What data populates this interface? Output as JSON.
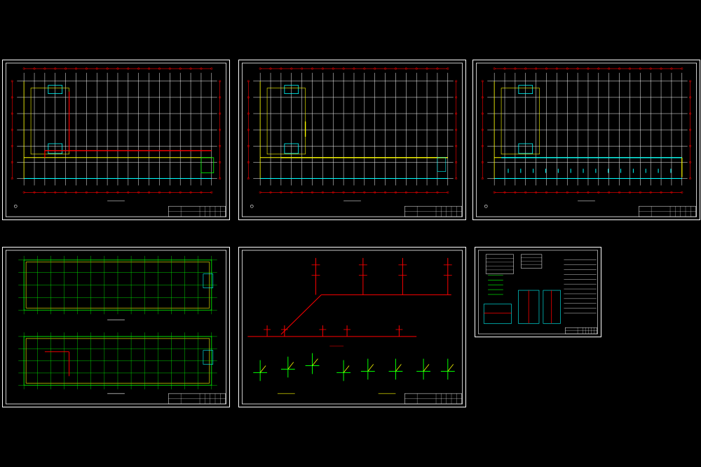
{
  "colors": {
    "background": "#000000",
    "frame": "#ffffff",
    "grid": "#ffffff",
    "axis": "#ff0000",
    "pipe_red": "#ff0000",
    "pipe_yellow": "#ffff00",
    "pipe_cyan": "#00ffff",
    "wall_green": "#00ff00"
  },
  "sheets": [
    {
      "id": "sheet-1",
      "kind": "floor-plan",
      "pipe_color": "pipe_red"
    },
    {
      "id": "sheet-2",
      "kind": "floor-plan",
      "pipe_color": "pipe_yellow"
    },
    {
      "id": "sheet-3",
      "kind": "floor-plan",
      "pipe_color": "pipe_cyan"
    },
    {
      "id": "sheet-4",
      "kind": "double-plan"
    },
    {
      "id": "sheet-5",
      "kind": "riser-diagram"
    },
    {
      "id": "sheet-6",
      "kind": "notes-and-details"
    }
  ]
}
